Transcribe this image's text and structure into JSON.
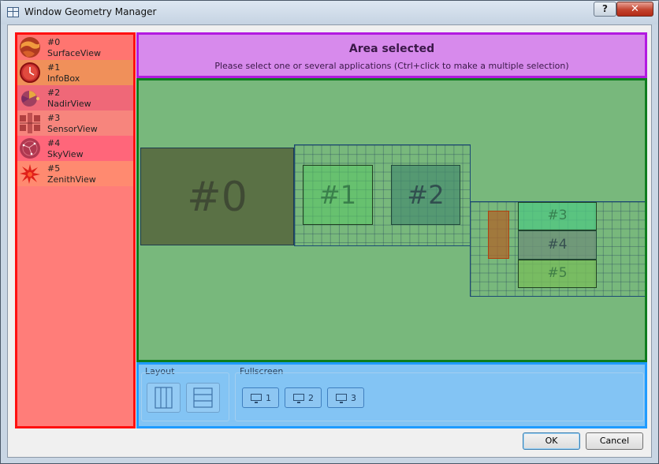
{
  "window": {
    "title": "Window Geometry Manager",
    "help_label": "?",
    "close_label": "✕"
  },
  "apps": [
    {
      "id": "#0",
      "name": "SurfaceView",
      "icon": "surface-icon",
      "color": "#ff7d79"
    },
    {
      "id": "#1",
      "name": "InfoBox",
      "icon": "clock-icon",
      "color": "#f0905a"
    },
    {
      "id": "#2",
      "name": "NadirView",
      "icon": "nadir-icon",
      "color": "#ef6878"
    },
    {
      "id": "#3",
      "name": "SensorView",
      "icon": "sensor-icon",
      "color": "#f7857d"
    },
    {
      "id": "#4",
      "name": "SkyView",
      "icon": "sky-icon",
      "color": "#ff667a"
    },
    {
      "id": "#5",
      "name": "ZenithView",
      "icon": "zenith-icon",
      "color": "#ff8a70"
    }
  ],
  "header": {
    "title": "Area selected",
    "subtitle": "Please select one or several applications (Ctrl+click to make a multiple selection)"
  },
  "canvas": {
    "windows": [
      "#0",
      "#1",
      "#2",
      "#3",
      "#4",
      "#5"
    ]
  },
  "layout": {
    "label": "Layout",
    "buttons": [
      "vertical-split-icon",
      "horizontal-split-icon"
    ]
  },
  "fullscreen": {
    "label": "Fullscreen",
    "buttons": [
      "1",
      "2",
      "3"
    ]
  },
  "footer": {
    "ok_label": "OK",
    "cancel_label": "Cancel"
  },
  "colors": {
    "list_border": "#ff1010",
    "header_border": "#b21ae0",
    "canvas_border": "#0e7d1e",
    "bottom_border": "#1f9bff"
  }
}
